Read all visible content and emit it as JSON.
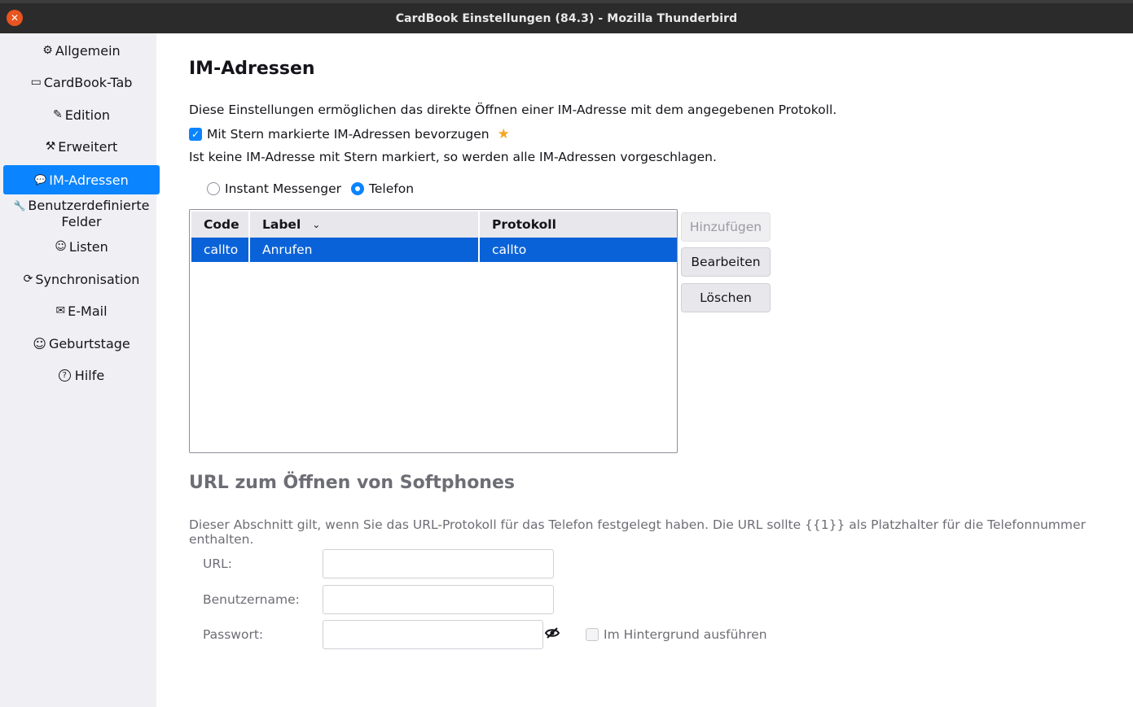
{
  "window": {
    "title": "CardBook Einstellungen (84.3) - Mozilla Thunderbird"
  },
  "sidebar": {
    "items": [
      {
        "label": "Allgemein",
        "icon": "gear-icon",
        "glyph": "⚙"
      },
      {
        "label": "CardBook-Tab",
        "icon": "tab-icon",
        "glyph": "▭"
      },
      {
        "label": "Edition",
        "icon": "pencil-icon",
        "glyph": "✎"
      },
      {
        "label": "Erweitert",
        "icon": "tools-icon",
        "glyph": "⚒"
      },
      {
        "label": "IM-Adressen",
        "icon": "chat-icon",
        "glyph": "💬"
      },
      {
        "label_line1": "Benutzerdefinierte",
        "label_line2": "Felder",
        "icon": "wrench-icon",
        "glyph": "🔧"
      },
      {
        "label": "Listen",
        "icon": "group-icon",
        "glyph": "☺"
      },
      {
        "label": "Synchronisation",
        "icon": "sync-icon",
        "glyph": "⟳"
      },
      {
        "label": "E-Mail",
        "icon": "mail-icon",
        "glyph": "✉"
      },
      {
        "label": "Geburtstage",
        "icon": "smiley-icon",
        "glyph": "☺"
      },
      {
        "label": "Hilfe",
        "icon": "help-icon",
        "glyph": "?"
      }
    ],
    "active": "IM-Adressen"
  },
  "main": {
    "title": "IM-Adressen",
    "description": "Diese Einstellungen ermöglichen das direkte Öffnen einer IM-Adresse mit dem angegebenen Protokoll.",
    "prefer_starred": {
      "label": "Mit Stern markierte IM-Adressen bevorzugen",
      "checked": true
    },
    "note": "Ist keine IM-Adresse mit Stern markiert, so werden alle IM-Adressen vorgeschlagen.",
    "type_options": [
      {
        "label": "Instant Messenger",
        "selected": false
      },
      {
        "label": "Telefon",
        "selected": true
      }
    ],
    "table": {
      "columns": [
        "Code",
        "Label",
        "Protokoll"
      ],
      "rows": [
        {
          "code": "callto",
          "label": "Anrufen",
          "protocol": "callto",
          "selected": true
        }
      ]
    },
    "buttons": {
      "add": "Hinzufügen",
      "edit": "Bearbeiten",
      "delete": "Löschen"
    }
  },
  "softphone": {
    "title": "URL zum Öffnen von Softphones",
    "description": "Dieser Abschnitt gilt, wenn Sie das URL-Protokoll für das Telefon festgelegt haben. Die URL sollte {{1}} als Platzhalter für die Telefonnummer enthalten.",
    "url_label": "URL:",
    "url_value": "",
    "username_label": "Benutzername:",
    "username_value": "",
    "password_label": "Passwort:",
    "password_value": "",
    "background_label": "Im Hintergrund ausführen",
    "background_checked": false
  },
  "colors": {
    "accent": "#0a84ff",
    "selection": "#0a62d8",
    "sidebar_bg": "#f0f0f4"
  }
}
